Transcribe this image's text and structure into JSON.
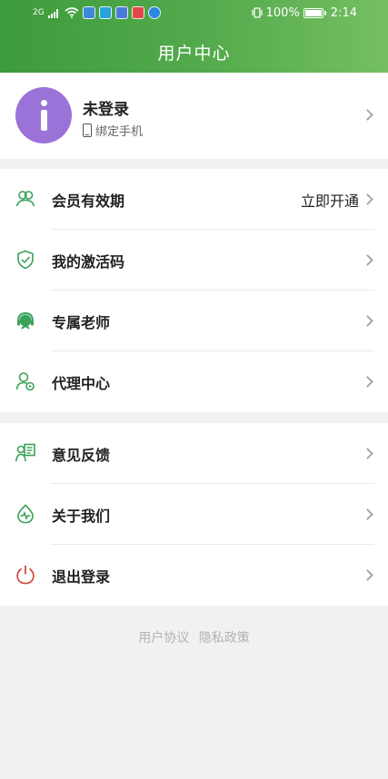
{
  "status_bar": {
    "network": "2G",
    "battery": "100%",
    "time": "2:14"
  },
  "header": {
    "title": "用户中心"
  },
  "profile": {
    "name": "未登录",
    "subtitle": "绑定手机"
  },
  "menu_group_1": [
    {
      "label": "会员有效期",
      "value": "立即开通",
      "icon": "members-icon"
    },
    {
      "label": "我的激活码",
      "value": "",
      "icon": "shield-check-icon"
    },
    {
      "label": "专属老师",
      "value": "",
      "icon": "teacher-icon"
    },
    {
      "label": "代理中心",
      "value": "",
      "icon": "agent-icon"
    }
  ],
  "menu_group_2": [
    {
      "label": "意见反馈",
      "icon": "feedback-icon"
    },
    {
      "label": "关于我们",
      "icon": "about-icon"
    },
    {
      "label": "退出登录",
      "icon": "power-icon"
    }
  ],
  "footer": {
    "user_agreement": "用户协议",
    "privacy_policy": "隐私政策"
  },
  "colors": {
    "primary_green": "#4aa645",
    "icon_green": "#3aa25a",
    "logout_red": "#d34a3a",
    "avatar_purple": "#9b72d8"
  }
}
